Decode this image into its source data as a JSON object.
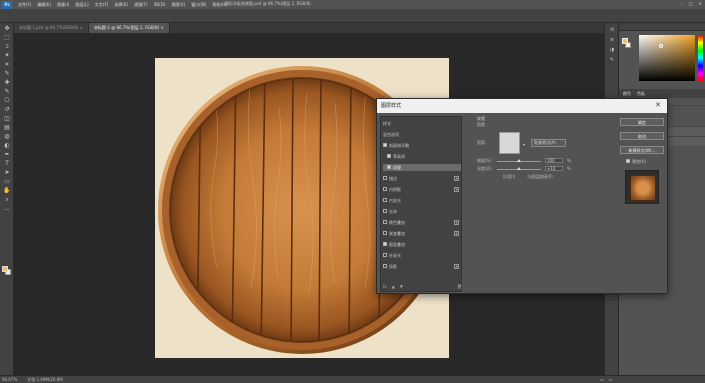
{
  "app": {
    "menu": [
      "文件(F)",
      "编辑(E)",
      "图像(I)",
      "图层(L)",
      "文字(Y)",
      "选择(S)",
      "滤镜(T)",
      "3D(D)",
      "视图(V)",
      "窗口(W)",
      "帮助(H)"
    ],
    "title": "圆形木板效果图.psd @ 66.7%(图层 2, RGB/8)",
    "logo": "Ps"
  },
  "tabs": [
    {
      "label": "未标题-1.psd @ 66.7%(RGB/8) ×"
    },
    {
      "label": "未标题-2 @ 66.7%(图层 2, RGB/8) ×"
    }
  ],
  "toolbar": {
    "icons": [
      "move-icon",
      "marquee-icon",
      "lasso-icon",
      "magic-wand-icon",
      "crop-icon",
      "eyedropper-icon",
      "healing-icon",
      "brush-icon",
      "stamp-icon",
      "history-brush-icon",
      "eraser-icon",
      "gradient-icon",
      "blur-icon",
      "dodge-icon",
      "pen-icon",
      "type-icon",
      "path-select-icon",
      "shape-icon",
      "hand-icon",
      "zoom-icon",
      "more-icon"
    ],
    "glyphs": [
      "✥",
      "⬚",
      "ↄ",
      "✦",
      "⌗",
      "✎",
      "✚",
      "✎",
      "⎔",
      "↺",
      "◫",
      "▤",
      "◍",
      "◐",
      "✒",
      "T",
      "➤",
      "▭",
      "✋",
      "⌕",
      "…"
    ],
    "fg_color": "#e5c36a",
    "bg_color": "#f2f2f2"
  },
  "status": {
    "zoom": "66.67%",
    "doc_info": "文档:1.69M/20.8M",
    "right": [
      "▭",
      "▭"
    ]
  },
  "right_panel": {
    "tabs": [
      "颜色",
      "色板"
    ],
    "fg_color": "#e8c06a"
  },
  "dialog": {
    "title": "图层样式",
    "close": "✕",
    "styles": [
      {
        "label": "样式",
        "checkbox": false,
        "plus": false,
        "active": false
      },
      {
        "label": "混合选项",
        "checkbox": false,
        "plus": false,
        "active": false
      },
      {
        "label": "斜面和浮雕",
        "checkbox": true,
        "checked": true,
        "plus": false,
        "active": false
      },
      {
        "label": "等高线",
        "checkbox": true,
        "checked": true,
        "plus": false,
        "active": false,
        "indent": true
      },
      {
        "label": "纹理",
        "checkbox": true,
        "checked": true,
        "plus": false,
        "active": true,
        "indent": true
      },
      {
        "label": "描边",
        "checkbox": true,
        "checked": false,
        "plus": true,
        "active": false
      },
      {
        "label": "内阴影",
        "checkbox": true,
        "checked": false,
        "plus": true,
        "active": false
      },
      {
        "label": "内发光",
        "checkbox": true,
        "checked": false,
        "plus": false,
        "active": false
      },
      {
        "label": "光泽",
        "checkbox": true,
        "checked": false,
        "plus": false,
        "active": false
      },
      {
        "label": "颜色叠加",
        "checkbox": true,
        "checked": false,
        "plus": true,
        "active": false
      },
      {
        "label": "渐变叠加",
        "checkbox": true,
        "checked": false,
        "plus": true,
        "active": false
      },
      {
        "label": "图案叠加",
        "checkbox": true,
        "checked": true,
        "plus": false,
        "active": false
      },
      {
        "label": "外发光",
        "checkbox": true,
        "checked": false,
        "plus": false,
        "active": false
      },
      {
        "label": "投影",
        "checkbox": true,
        "checked": false,
        "plus": true,
        "active": false
      }
    ],
    "footer_icons": [
      "fx",
      "▲",
      "▼",
      "🗑"
    ],
    "section": {
      "title": "纹理",
      "subtitle": "图素",
      "pattern_label": "图案:",
      "dropdown_glyph": "▾",
      "snap_origin": "贴紧原点(A)",
      "scale_label": "缩放(S):",
      "scale_value": "100",
      "depth_label": "深度(D):",
      "depth_value": "+10",
      "percent": "%",
      "invert_label": "反相(I)",
      "link_label": "与图层链接(K)",
      "scale_fraction": 0.5,
      "depth_fraction": 0.5
    },
    "buttons": {
      "ok": "确定",
      "cancel": "取消",
      "new_style": "新建样式(W)...",
      "preview": "预览(V)"
    }
  }
}
